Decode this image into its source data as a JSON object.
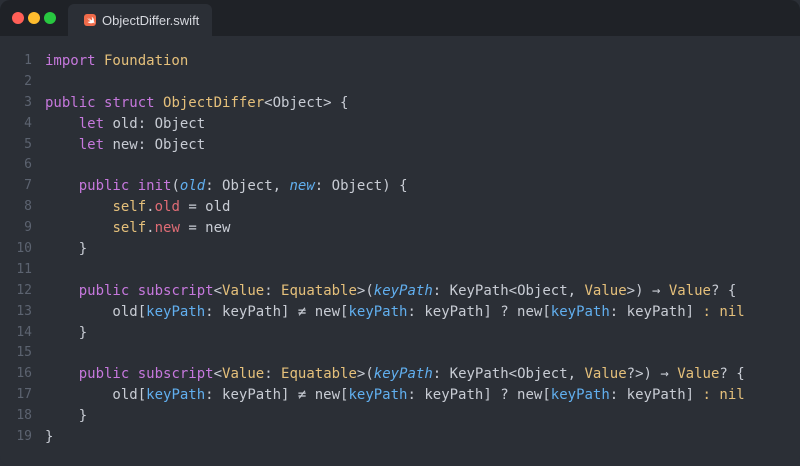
{
  "window": {
    "tab_label": "ObjectDiffer.swift"
  },
  "editor": {
    "lines": [
      {
        "num": "1",
        "tokens": [
          {
            "t": "import",
            "k": "kw"
          },
          {
            "t": " Foundation",
            "k": "type"
          }
        ]
      },
      {
        "num": "2",
        "tokens": []
      },
      {
        "num": "3",
        "tokens": [
          {
            "t": "public",
            "k": "kw"
          },
          {
            "t": " ",
            "k": "plain"
          },
          {
            "t": "struct",
            "k": "kw"
          },
          {
            "t": " ObjectDiffer",
            "k": "type"
          },
          {
            "t": "<Object> {",
            "k": "plain"
          }
        ]
      },
      {
        "num": "4",
        "tokens": [
          {
            "t": "    ",
            "k": "plain"
          },
          {
            "t": "let",
            "k": "kw"
          },
          {
            "t": " old: Object",
            "k": "plain"
          }
        ]
      },
      {
        "num": "5",
        "tokens": [
          {
            "t": "    ",
            "k": "plain"
          },
          {
            "t": "let",
            "k": "kw"
          },
          {
            "t": " new: Object",
            "k": "plain"
          }
        ]
      },
      {
        "num": "6",
        "tokens": []
      },
      {
        "num": "7",
        "tokens": [
          {
            "t": "    ",
            "k": "plain"
          },
          {
            "t": "public",
            "k": "kw"
          },
          {
            "t": " ",
            "k": "plain"
          },
          {
            "t": "init",
            "k": "kw"
          },
          {
            "t": "(",
            "k": "plain"
          },
          {
            "t": "old",
            "k": "param-i"
          },
          {
            "t": ": Object, ",
            "k": "plain"
          },
          {
            "t": "new",
            "k": "param-i"
          },
          {
            "t": ": Object) {",
            "k": "plain"
          }
        ]
      },
      {
        "num": "8",
        "tokens": [
          {
            "t": "        ",
            "k": "plain"
          },
          {
            "t": "self",
            "k": "type"
          },
          {
            "t": ".",
            "k": "plain"
          },
          {
            "t": "old",
            "k": "prop"
          },
          {
            "t": " = old",
            "k": "plain"
          }
        ]
      },
      {
        "num": "9",
        "tokens": [
          {
            "t": "        ",
            "k": "plain"
          },
          {
            "t": "self",
            "k": "type"
          },
          {
            "t": ".",
            "k": "plain"
          },
          {
            "t": "new",
            "k": "prop"
          },
          {
            "t": " = new",
            "k": "plain"
          }
        ]
      },
      {
        "num": "10",
        "tokens": [
          {
            "t": "    }",
            "k": "plain"
          }
        ]
      },
      {
        "num": "11",
        "tokens": []
      },
      {
        "num": "12",
        "tokens": [
          {
            "t": "    ",
            "k": "plain"
          },
          {
            "t": "public",
            "k": "kw"
          },
          {
            "t": " ",
            "k": "plain"
          },
          {
            "t": "subscript",
            "k": "kw"
          },
          {
            "t": "<",
            "k": "plain"
          },
          {
            "t": "Value",
            "k": "type"
          },
          {
            "t": ": ",
            "k": "plain"
          },
          {
            "t": "Equatable",
            "k": "type"
          },
          {
            "t": ">(",
            "k": "plain"
          },
          {
            "t": "keyPath",
            "k": "param-i"
          },
          {
            "t": ": KeyPath<Object, ",
            "k": "plain"
          },
          {
            "t": "Value",
            "k": "type"
          },
          {
            "t": ">) → ",
            "k": "plain"
          },
          {
            "t": "Value",
            "k": "type"
          },
          {
            "t": "? {",
            "k": "plain"
          }
        ]
      },
      {
        "num": "13",
        "tokens": [
          {
            "t": "        old[",
            "k": "plain"
          },
          {
            "t": "keyPath",
            "k": "param"
          },
          {
            "t": ": keyPath] ≠ new[",
            "k": "plain"
          },
          {
            "t": "keyPath",
            "k": "param"
          },
          {
            "t": ": keyPath] ? new[",
            "k": "plain"
          },
          {
            "t": "keyPath",
            "k": "param"
          },
          {
            "t": ": keyPath] ",
            "k": "plain"
          },
          {
            "t": ":",
            "k": "op"
          },
          {
            "t": " ",
            "k": "plain"
          },
          {
            "t": "nil",
            "k": "op"
          }
        ]
      },
      {
        "num": "14",
        "tokens": [
          {
            "t": "    }",
            "k": "plain"
          }
        ]
      },
      {
        "num": "15",
        "tokens": []
      },
      {
        "num": "16",
        "tokens": [
          {
            "t": "    ",
            "k": "plain"
          },
          {
            "t": "public",
            "k": "kw"
          },
          {
            "t": " ",
            "k": "plain"
          },
          {
            "t": "subscript",
            "k": "kw"
          },
          {
            "t": "<",
            "k": "plain"
          },
          {
            "t": "Value",
            "k": "type"
          },
          {
            "t": ": ",
            "k": "plain"
          },
          {
            "t": "Equatable",
            "k": "type"
          },
          {
            "t": ">(",
            "k": "plain"
          },
          {
            "t": "keyPath",
            "k": "param-i"
          },
          {
            "t": ": KeyPath<Object, ",
            "k": "plain"
          },
          {
            "t": "Value",
            "k": "type"
          },
          {
            "t": "?>) → ",
            "k": "plain"
          },
          {
            "t": "Value",
            "k": "type"
          },
          {
            "t": "? {",
            "k": "plain"
          }
        ]
      },
      {
        "num": "17",
        "tokens": [
          {
            "t": "        old[",
            "k": "plain"
          },
          {
            "t": "keyPath",
            "k": "param"
          },
          {
            "t": ": keyPath] ≠ new[",
            "k": "plain"
          },
          {
            "t": "keyPath",
            "k": "param"
          },
          {
            "t": ": keyPath] ? new[",
            "k": "plain"
          },
          {
            "t": "keyPath",
            "k": "param"
          },
          {
            "t": ": keyPath] ",
            "k": "plain"
          },
          {
            "t": ":",
            "k": "op"
          },
          {
            "t": " ",
            "k": "plain"
          },
          {
            "t": "nil",
            "k": "op"
          }
        ]
      },
      {
        "num": "18",
        "tokens": [
          {
            "t": "    }",
            "k": "plain"
          }
        ]
      },
      {
        "num": "19",
        "tokens": [
          {
            "t": "}",
            "k": "plain"
          }
        ]
      }
    ]
  },
  "colors": {
    "background": "#2b2f36",
    "titlebar": "#1f2227",
    "keyword": "#c678dd",
    "type": "#e5c07b",
    "param": "#61afef",
    "property": "#e06c75"
  },
  "icons": {
    "close": "red-dot",
    "minimize": "yellow-dot",
    "zoom": "green-dot",
    "file": "swift-icon"
  }
}
